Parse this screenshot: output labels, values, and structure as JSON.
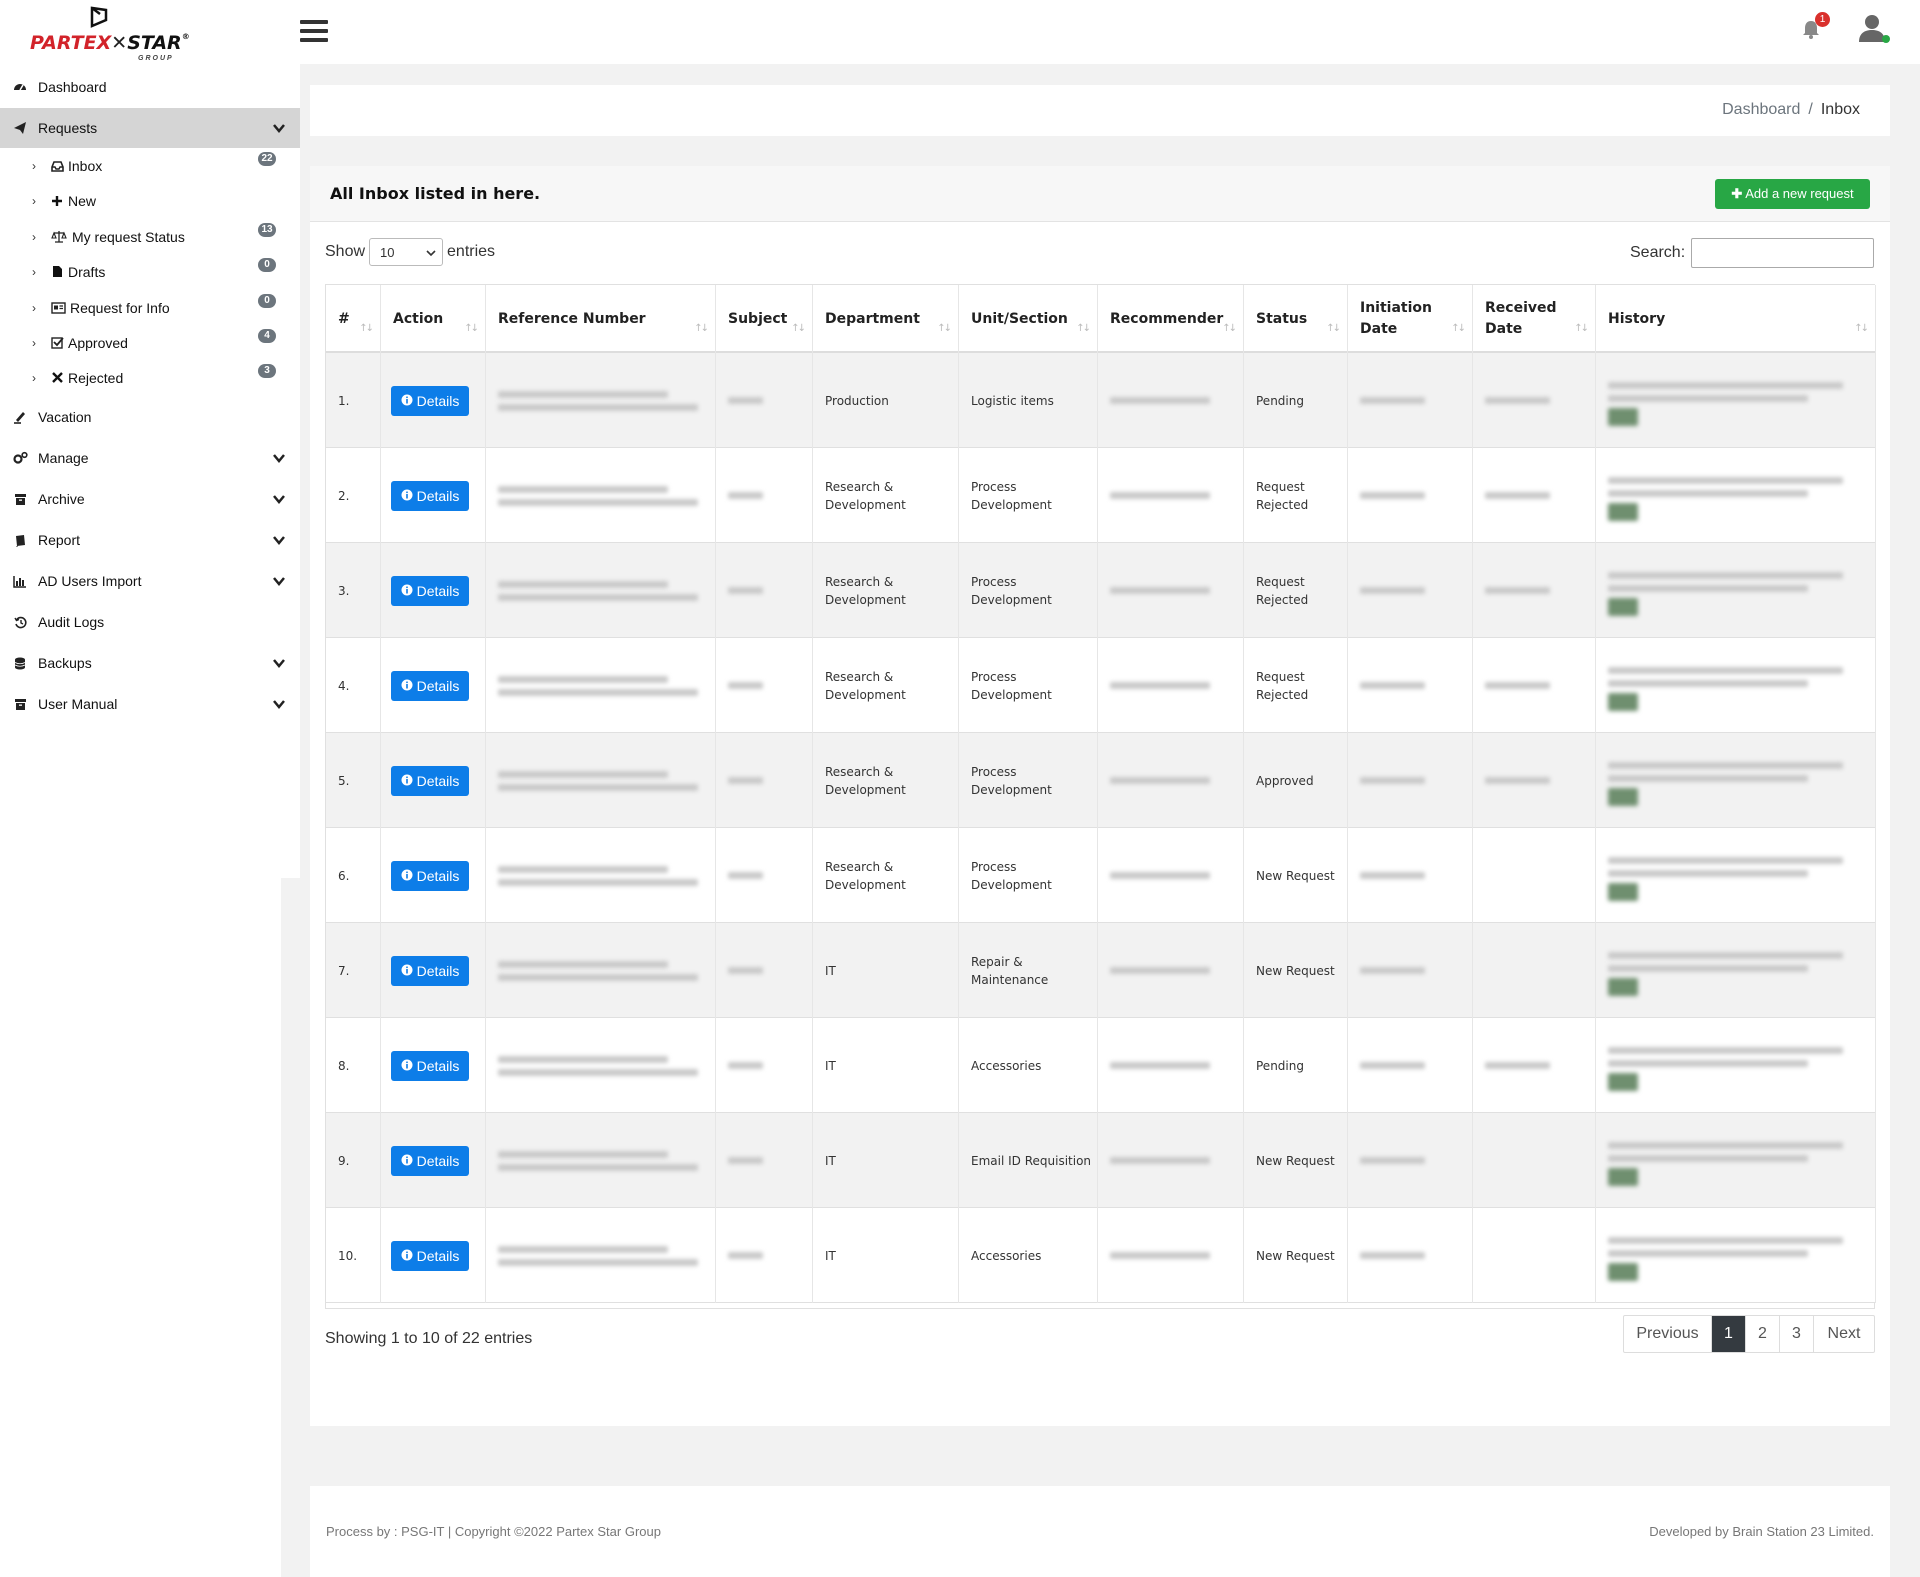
{
  "logo": {
    "brand_part1": "PARTEX",
    "brand_part2": "STAR",
    "group": "GROUP",
    "trademark": "®"
  },
  "header": {
    "notification_count": "1"
  },
  "sidebar": {
    "items": [
      {
        "label": "Dashboard",
        "icon": "dashboard-icon"
      },
      {
        "label": "Requests",
        "icon": "paper-plane-icon",
        "expanded": true
      },
      {
        "label": "Vacation",
        "icon": "pen-icon"
      },
      {
        "label": "Manage",
        "icon": "cogs-icon"
      },
      {
        "label": "Archive",
        "icon": "archive-icon"
      },
      {
        "label": "Report",
        "icon": "book-icon"
      },
      {
        "label": "AD Users Import",
        "icon": "bar-chart-icon"
      },
      {
        "label": "Audit Logs",
        "icon": "history-icon"
      },
      {
        "label": "Backups",
        "icon": "database-icon"
      },
      {
        "label": "User Manual",
        "icon": "archive-icon"
      }
    ],
    "requests_sub": [
      {
        "label": "Inbox",
        "icon": "inbox-icon",
        "badge": "22"
      },
      {
        "label": "New",
        "icon": "plus-icon",
        "badge": ""
      },
      {
        "label": "My request Status",
        "icon": "balance-scale-icon",
        "badge": "13"
      },
      {
        "label": "Drafts",
        "icon": "file-icon",
        "badge": "0"
      },
      {
        "label": "Request for Info",
        "icon": "id-card-icon",
        "badge": "0"
      },
      {
        "label": "Approved",
        "icon": "check-square-icon",
        "badge": "4"
      },
      {
        "label": "Rejected",
        "icon": "times-icon",
        "badge": "3"
      }
    ]
  },
  "breadcrumb": {
    "parent": "Dashboard",
    "separator": "/",
    "current": "Inbox"
  },
  "card": {
    "title": "All Inbox listed in here.",
    "add_button": "Add a new request",
    "show_label": "Show",
    "show_value": "10",
    "entries_label": "entries",
    "search_label": "Search:",
    "search_value": ""
  },
  "table": {
    "columns": [
      "#",
      "Action",
      "Reference Number",
      "Subject",
      "Department",
      "Unit/Section",
      "Recommender",
      "Status",
      "Initiation Date",
      "Received Date",
      "History"
    ],
    "details_label": "Details",
    "rows": [
      {
        "num": "1.",
        "department": "Production",
        "unit": "Logistic items",
        "status": "Pending",
        "received": true
      },
      {
        "num": "2.",
        "department": "Research & Development",
        "unit": "Process Development",
        "status": "Request Rejected",
        "received": true
      },
      {
        "num": "3.",
        "department": "Research & Development",
        "unit": "Process Development",
        "status": "Request Rejected",
        "received": true
      },
      {
        "num": "4.",
        "department": "Research & Development",
        "unit": "Process Development",
        "status": "Request Rejected",
        "received": true
      },
      {
        "num": "5.",
        "department": "Research & Development",
        "unit": "Process Development",
        "status": "Approved",
        "received": true
      },
      {
        "num": "6.",
        "department": "Research & Development",
        "unit": "Process Development",
        "status": "New Request",
        "received": false
      },
      {
        "num": "7.",
        "department": "IT",
        "unit": "Repair & Maintenance",
        "status": "New Request",
        "received": false
      },
      {
        "num": "8.",
        "department": "IT",
        "unit": "Accessories",
        "status": "Pending",
        "received": true
      },
      {
        "num": "9.",
        "department": "IT",
        "unit": "Email ID Requisition",
        "status": "New Request",
        "received": false
      },
      {
        "num": "10.",
        "department": "IT",
        "unit": "Accessories",
        "status": "New Request",
        "received": false
      }
    ]
  },
  "pagination": {
    "showing": "Showing 1 to 10 of 22 entries",
    "previous": "Previous",
    "pages": [
      "1",
      "2",
      "3"
    ],
    "active": "1",
    "next": "Next"
  },
  "footer": {
    "left": "Process by : PSG-IT | Copyright ©2022 Partex Star Group",
    "right": "Developed by Brain Station 23 Limited."
  }
}
